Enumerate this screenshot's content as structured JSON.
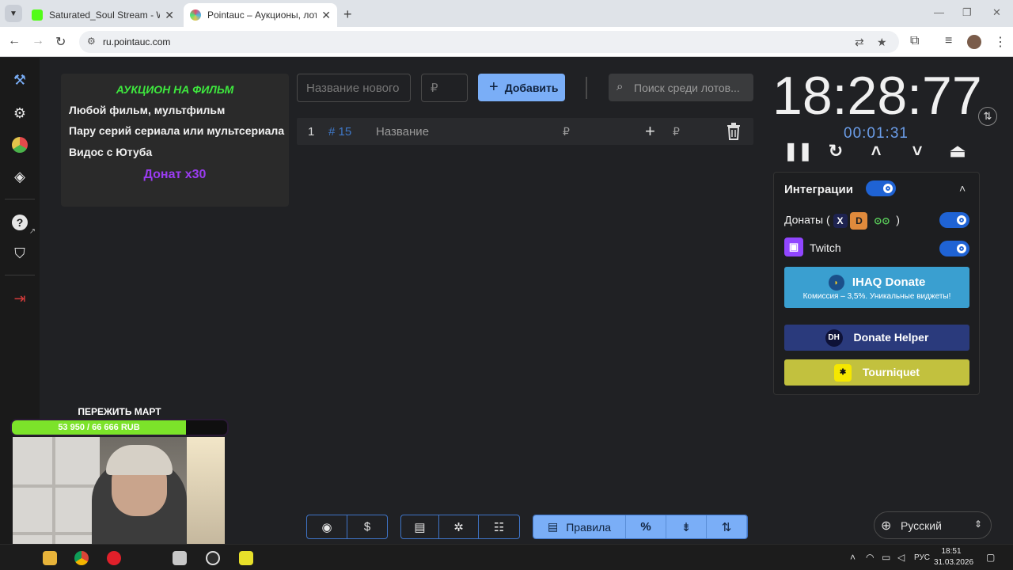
{
  "browser": {
    "tabs": [
      {
        "title": "Saturated_Soul Stream - Watch",
        "favicon_color": "#53fc18"
      },
      {
        "title": "Pointauc – Аукционы, лотереи",
        "favicon_color": "#e34b6a"
      }
    ],
    "url": "ru.pointauc.com",
    "new_tab_glyph": "+",
    "close_glyph": "✕"
  },
  "rules": {
    "title": "АУКЦИОН НА ФИЛЬМ",
    "lines": [
      "Любой фильм, мультфильм",
      "Пару серий сериала или мультсериала",
      "Видос с Ютуба"
    ],
    "donate": "Донат x30"
  },
  "toolbar": {
    "name_placeholder": "Название нового лота",
    "amount_placeholder": "₽",
    "add_label": "Добавить",
    "search_placeholder": "Поиск среди лотов..."
  },
  "lots": [
    {
      "num": "1",
      "id": "# 15",
      "name": "Название",
      "currency": "₽",
      "add_currency": "₽"
    }
  ],
  "timer": {
    "main": "18:28:77",
    "secondary": "00:01:31"
  },
  "integrations": {
    "title": "Интеграции",
    "donations_label_open": "Донаты (",
    "donations_label_close": ")",
    "donation_icons": [
      "X",
      "D",
      "⊙⊙"
    ],
    "twitch_label": "Twitch",
    "ihaq": {
      "name": "IHAQ Donate",
      "sub": "Комиссия – 3,5%. Уникальные виджеты!"
    },
    "donate_helper": {
      "name": "Donate Helper",
      "logo": "DH"
    },
    "tourniquet": {
      "name": "Tourniquet"
    }
  },
  "bottom": {
    "rules_label": "Правила",
    "percent_label": "%"
  },
  "language": {
    "selected": "Русский"
  },
  "overlay": {
    "goal_title": "ПЕРЕЖИТЬ МАРТ",
    "goal_text": "53 950 / 66 666 RUB",
    "goal_progress": 0.81
  },
  "taskbar": {
    "lang": "РУС",
    "time": "18:51",
    "date": "31.03.2026"
  },
  "colors": {
    "accent": "#7aaef7",
    "rules_title": "#3ee83e",
    "donate_purple": "#9b3cf2",
    "timer_secondary": "#6b9de8",
    "twitch": "#9146ff"
  }
}
